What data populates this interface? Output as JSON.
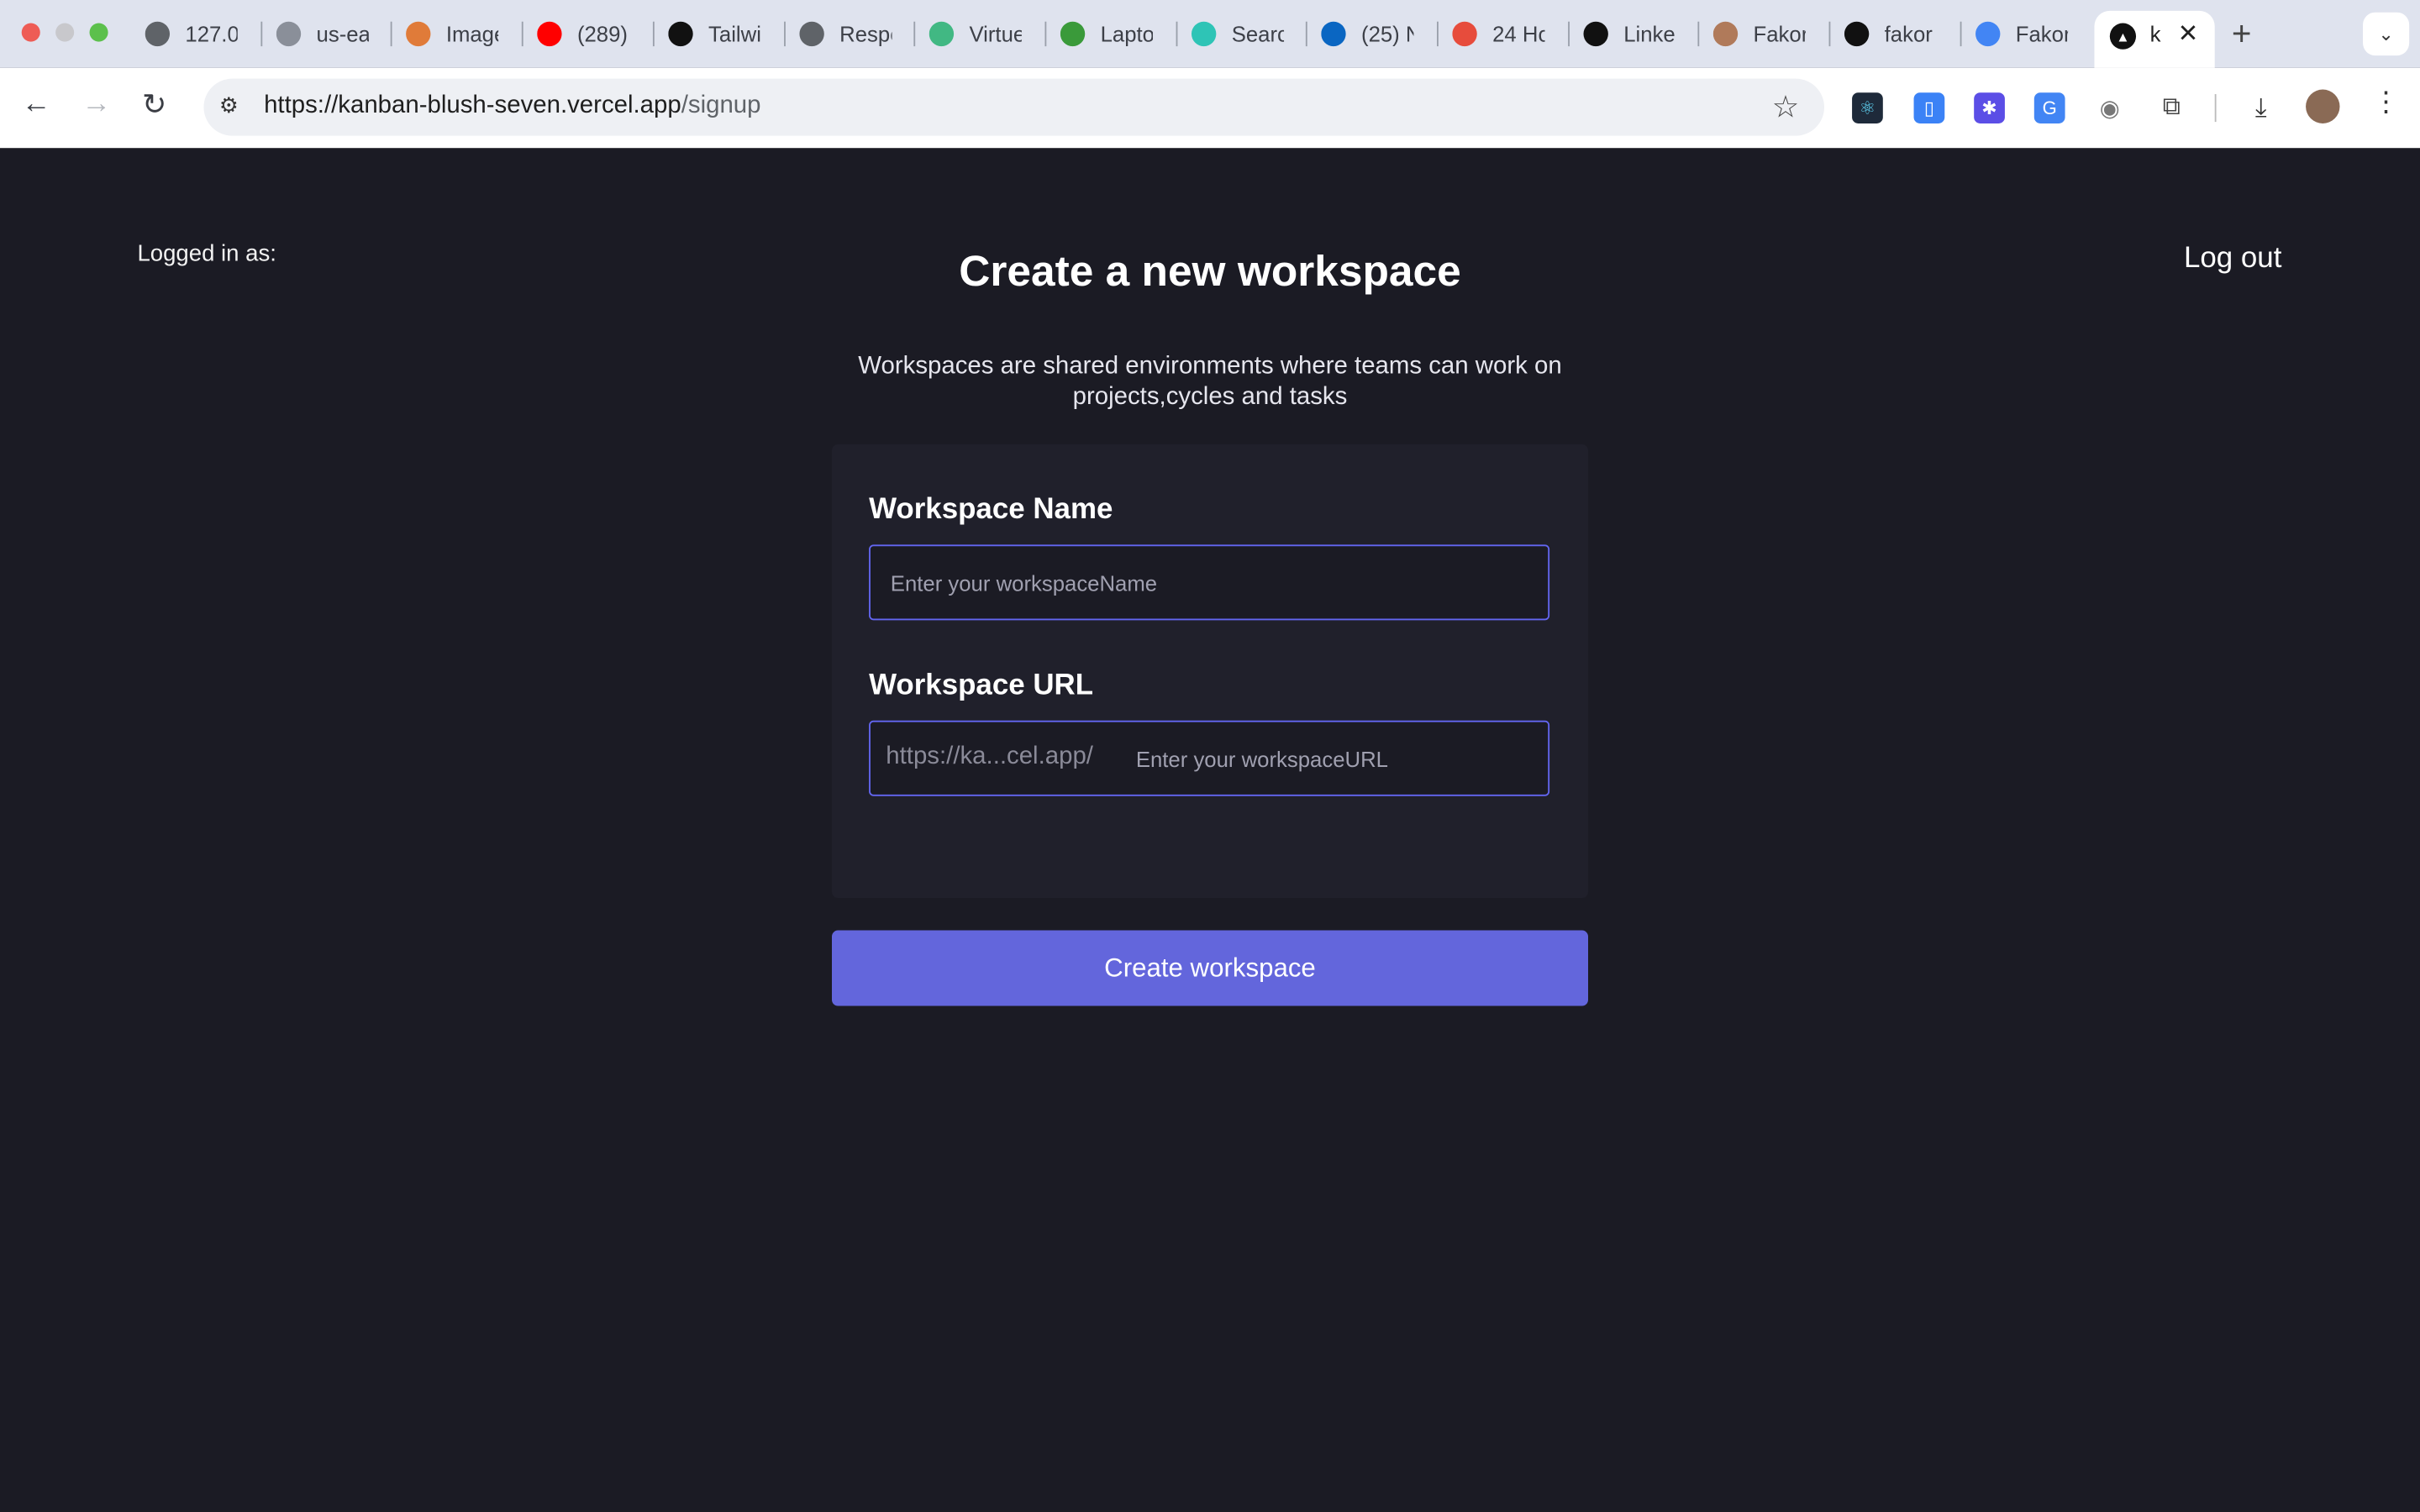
{
  "browser": {
    "tabs": [
      {
        "label": "127.0",
        "icon": "globe-icon",
        "color": "#5f6368"
      },
      {
        "label": "us-ea",
        "icon": "aws-icon",
        "color": "#8a8f99"
      },
      {
        "label": "Image",
        "icon": "image-tool-icon",
        "color": "#e07b39"
      },
      {
        "label": "(289)",
        "icon": "youtube-icon",
        "color": "#ff0000"
      },
      {
        "label": "Tailwi",
        "icon": "openai-icon",
        "color": "#111111"
      },
      {
        "label": "Respo",
        "icon": "globe-icon",
        "color": "#5f6368"
      },
      {
        "label": "Virtue",
        "icon": "vue-icon",
        "color": "#41b883"
      },
      {
        "label": "Lapto",
        "icon": "px-icon",
        "color": "#3a9a3a"
      },
      {
        "label": "Searc",
        "icon": "search-brand-icon",
        "color": "#2ec4b6"
      },
      {
        "label": "(25) N",
        "icon": "linkedin-icon",
        "color": "#0a66c2"
      },
      {
        "label": "24 Ho",
        "icon": "location-pin-icon",
        "color": "#e74c3c"
      },
      {
        "label": "Linke",
        "icon": "openai-icon",
        "color": "#111111"
      },
      {
        "label": "Fakor",
        "icon": "profile-icon",
        "color": "#b07a5a"
      },
      {
        "label": "fakor",
        "icon": "github-icon",
        "color": "#111111"
      },
      {
        "label": "Fakor",
        "icon": "docs-icon",
        "color": "#4285f4"
      }
    ],
    "active_tab": {
      "label": "k",
      "icon": "vercel-icon"
    },
    "url_host": "https://kanban-blush-seven.vercel.app",
    "url_path": "/signup"
  },
  "header": {
    "logged_in_label": "Logged in as:",
    "logout_label": "Log out"
  },
  "main": {
    "title": "Create a new workspace",
    "subtitle": "Workspaces are shared environments where teams can work on projects,cycles and tasks"
  },
  "form": {
    "name_label": "Workspace Name",
    "name_value": "",
    "name_placeholder": "Enter your workspaceName",
    "url_label": "Workspace URL",
    "url_prefix": "https://ka...cel.app/",
    "url_value": "",
    "url_placeholder": "Enter your workspaceURL",
    "submit_label": "Create workspace"
  },
  "colors": {
    "background": "#1b1b24",
    "card": "#20202b",
    "accent": "#6366dc",
    "input_border": "#6366f1"
  }
}
